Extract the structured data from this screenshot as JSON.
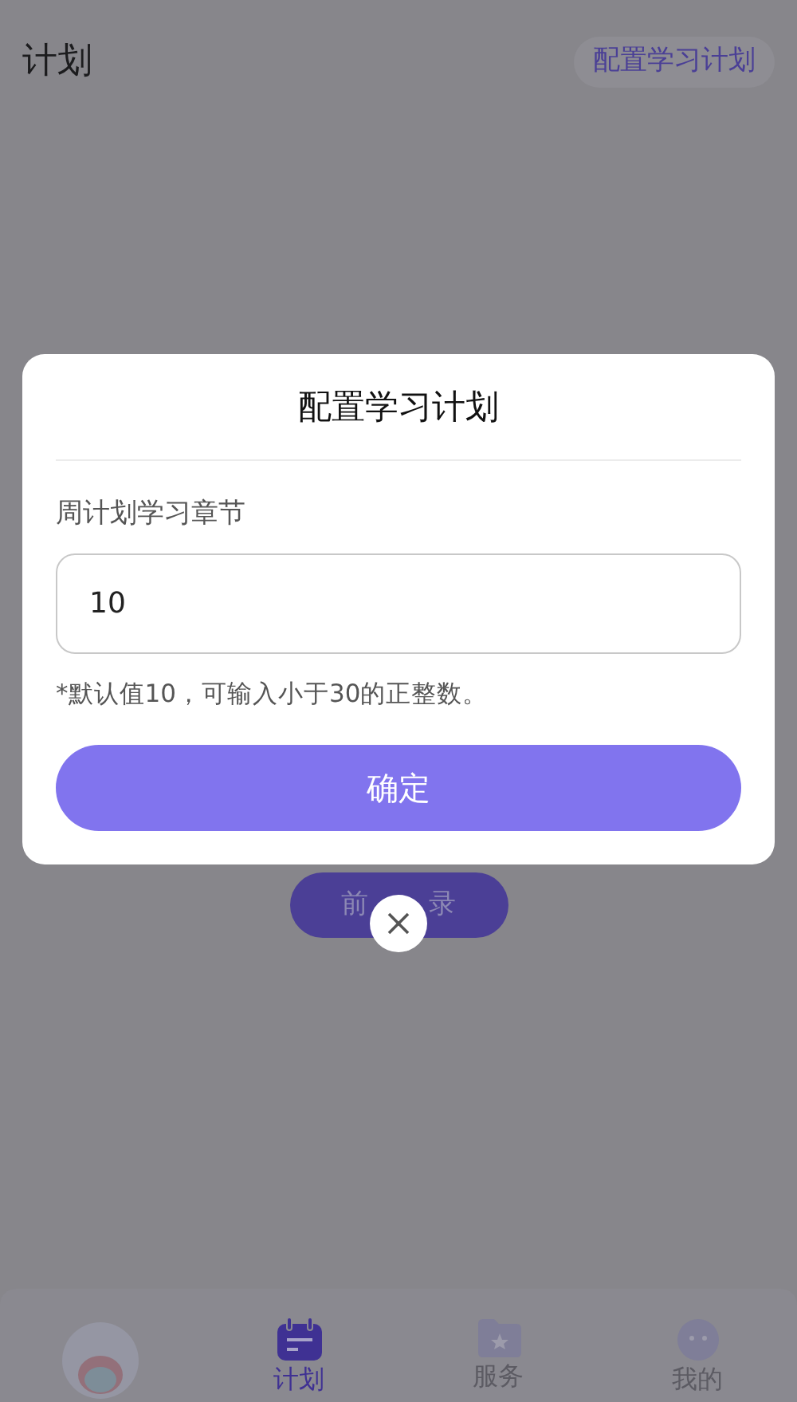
{
  "header": {
    "title": "计划",
    "action": "配置学习计划"
  },
  "login_button": {
    "visible_start": "前",
    "visible_end": "录"
  },
  "dialog": {
    "title": "配置学习计划",
    "field_label": "周计划学习章节",
    "value": "10",
    "hint": "*默认值10，可输入小于30的正整数。",
    "confirm": "确定"
  },
  "tabs": [
    {
      "kind": "avatar"
    },
    {
      "kind": "tab",
      "label": "计划",
      "selected": true
    },
    {
      "kind": "tab",
      "label": "服务",
      "selected": false
    },
    {
      "kind": "tab",
      "label": "我的",
      "selected": false
    }
  ]
}
